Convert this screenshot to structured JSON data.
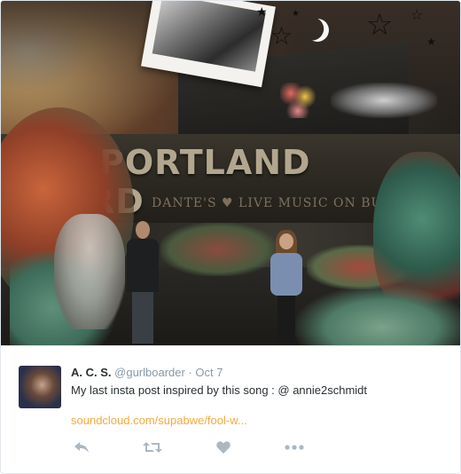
{
  "media": {
    "sign_text": "EEP PORTLAND WEIRD",
    "sub_text": "DANTE'S ♥ LIVE MUSIC ON BU"
  },
  "tweet": {
    "name": "A. C. S.",
    "handle": "@gurlboarder",
    "separator": "·",
    "date": "Oct 7",
    "text": "My last insta post inspired by this song : @ annie2schmidt",
    "link": "soundcloud.com/supabwe/fool-w..."
  },
  "actions": {
    "reply": "reply-icon",
    "retweet": "retweet-icon",
    "like": "heart-icon",
    "more": "more-icon"
  },
  "colors": {
    "link": "#f7a93c",
    "muted": "#8899a6",
    "text": "#292f33",
    "action_icon": "#aab8c2"
  }
}
